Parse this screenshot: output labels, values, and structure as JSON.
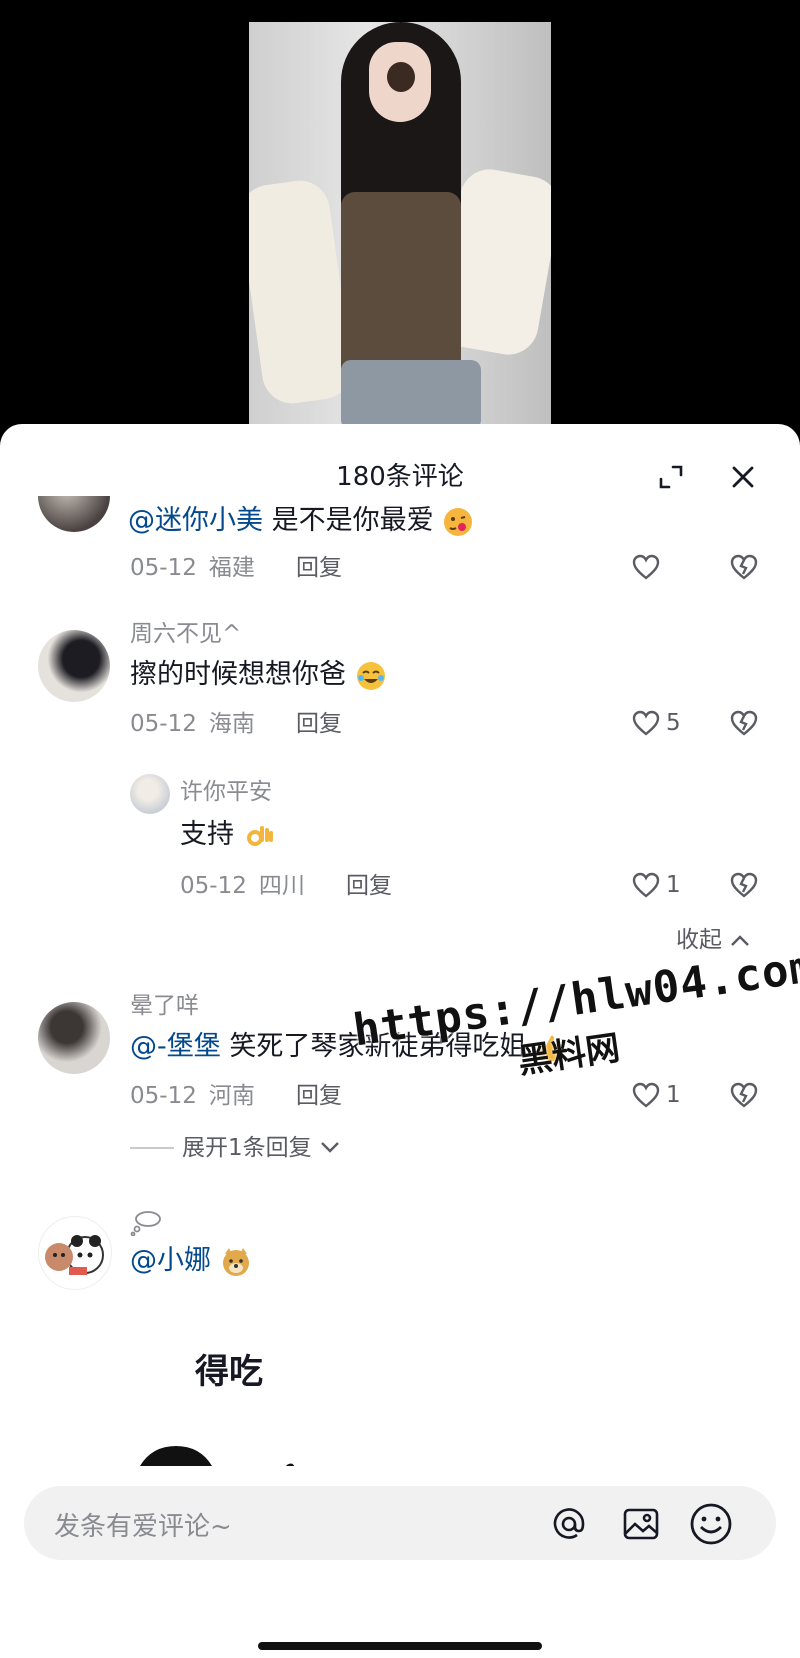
{
  "header": {
    "title": "180条评论"
  },
  "comments": [
    {
      "mention": "@迷你小美",
      "text": " 是不是你最爱",
      "date": "05-12",
      "location": "福建",
      "reply_label": "回复",
      "likes": ""
    },
    {
      "username": "周六不见^",
      "text": "擦的时候想想你爸",
      "date": "05-12",
      "location": "海南",
      "reply_label": "回复",
      "likes": "5",
      "replies": [
        {
          "username": "许你平安",
          "text": "支持",
          "date": "05-12",
          "location": "四川",
          "reply_label": "回复",
          "likes": "1"
        }
      ],
      "collapse_label": "收起"
    },
    {
      "username": "晕了咩",
      "mention": "@-堡堡",
      "text": " 笑死了琴家新徒弟得吃姐",
      "date": "05-12",
      "location": "河南",
      "reply_label": "回复",
      "likes": "1",
      "expand_label": "展开1条回复"
    },
    {
      "username": "",
      "mention": "@小娜",
      "sticker_text": "得吃"
    }
  ],
  "input": {
    "placeholder": "发条有爱评论~"
  },
  "watermark": {
    "url": "https://hlw04.com",
    "label": "黑料网"
  },
  "colors": {
    "mention": "#04498d",
    "secondary_text": "#8a8b91",
    "sheet_bg": "#ffffff",
    "page_bg": "#000000"
  }
}
